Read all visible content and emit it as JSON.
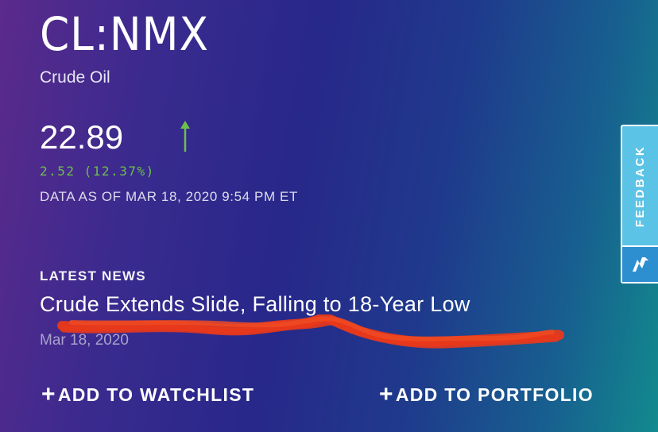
{
  "quote": {
    "symbol": "CL:NMX",
    "name": "Crude Oil",
    "price": "22.89",
    "trend": "up-arrow-icon",
    "change": "2.52 (12.37%)",
    "as_of": "DATA AS OF MAR 18, 2020 9:54 PM ET"
  },
  "news": {
    "section_label": "LATEST NEWS",
    "headline": "Crude Extends Slide, Falling to 18-Year Low",
    "date": "Mar 18, 2020"
  },
  "actions": {
    "plus_icon": "+",
    "watchlist": "ADD TO WATCHLIST",
    "portfolio": "ADD TO PORTFOLIO"
  },
  "feedback": {
    "label": "FEEDBACK",
    "logo_icon": "brand-logo-icon"
  },
  "colors": {
    "positive": "#6cc04a",
    "feedback_tab": "#5bc3e6",
    "feedback_logo": "#2e8fd0",
    "scribble": "#e8391b"
  }
}
